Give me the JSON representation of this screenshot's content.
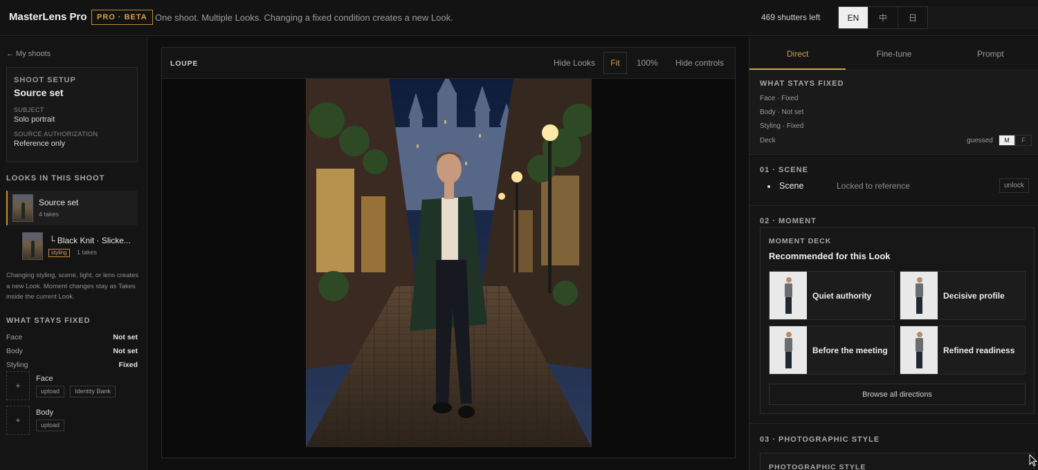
{
  "app": {
    "brand": "MasterLens Pro",
    "badge": "PRO · BETA",
    "tagline": "One shoot. Multiple Looks. Changing a fixed condition creates a new Look.",
    "shutters": "469 shutters left",
    "languages": [
      "EN",
      "中",
      "日"
    ],
    "active_language": "EN"
  },
  "left": {
    "back": "← My shoots",
    "setup": {
      "eyebrow": "SHOOT SETUP",
      "title": "Source set",
      "subject_label": "SUBJECT",
      "subject_value": "Solo portrait",
      "auth_label": "SOURCE AUTHORIZATION",
      "auth_value": "Reference only"
    },
    "looks_heading": "LOOKS IN THIS SHOOT",
    "looks": [
      {
        "name": "Source set",
        "takes": "4 takes"
      },
      {
        "name": "└ Black Knit · Slicke...",
        "tag": "styling",
        "takes": "1 takes"
      }
    ],
    "note": "Changing styling, scene, light, or lens creates a new Look. Moment changes stay as Takes inside the current Look.",
    "fixed_heading": "WHAT STAYS FIXED",
    "fixed": [
      {
        "label": "Face",
        "value": "Not set"
      },
      {
        "label": "Body",
        "value": "Not set"
      },
      {
        "label": "Styling",
        "value": "Fixed"
      }
    ],
    "uploads": [
      {
        "name": "Face",
        "plus": "+",
        "buttons": [
          "upload",
          "Identity Bank"
        ]
      },
      {
        "name": "Body",
        "plus": "+",
        "buttons": [
          "upload"
        ]
      }
    ]
  },
  "loupe": {
    "title": "LOUPE",
    "tools": {
      "hide_looks": "Hide Looks",
      "fit": "Fit",
      "zoom": "100%",
      "hide_controls": "Hide controls"
    }
  },
  "right": {
    "tabs": [
      "Direct",
      "Fine-tune",
      "Prompt"
    ],
    "active_tab": "Direct",
    "fixed_heading": "WHAT STAYS FIXED",
    "fixed_lines": [
      "Face · Fixed",
      "Body · Not set",
      "Styling · Fixed"
    ],
    "deck_label": "Deck",
    "guessed": "guessed",
    "gender": [
      "M",
      "F"
    ],
    "selected_gender": "M",
    "scene_heading": "01 · SCENE",
    "scene_item": "Scene",
    "scene_status": "Locked to reference",
    "unlock": "unlock",
    "moment_heading": "02 · MOMENT",
    "deck_eyebrow": "MOMENT DECK",
    "deck_title": "Recommended for this Look",
    "cards": [
      "Quiet authority",
      "Decisive profile",
      "Before the meeting",
      "Refined readiness"
    ],
    "browse": "Browse all directions",
    "photo_heading": "03 · PHOTOGRAPHIC STYLE",
    "photo_box_label": "PHOTOGRAPHIC STYLE"
  },
  "colors": {
    "accent": "#d5a04a",
    "background": "#0f0f0f",
    "panel": "#151515"
  }
}
